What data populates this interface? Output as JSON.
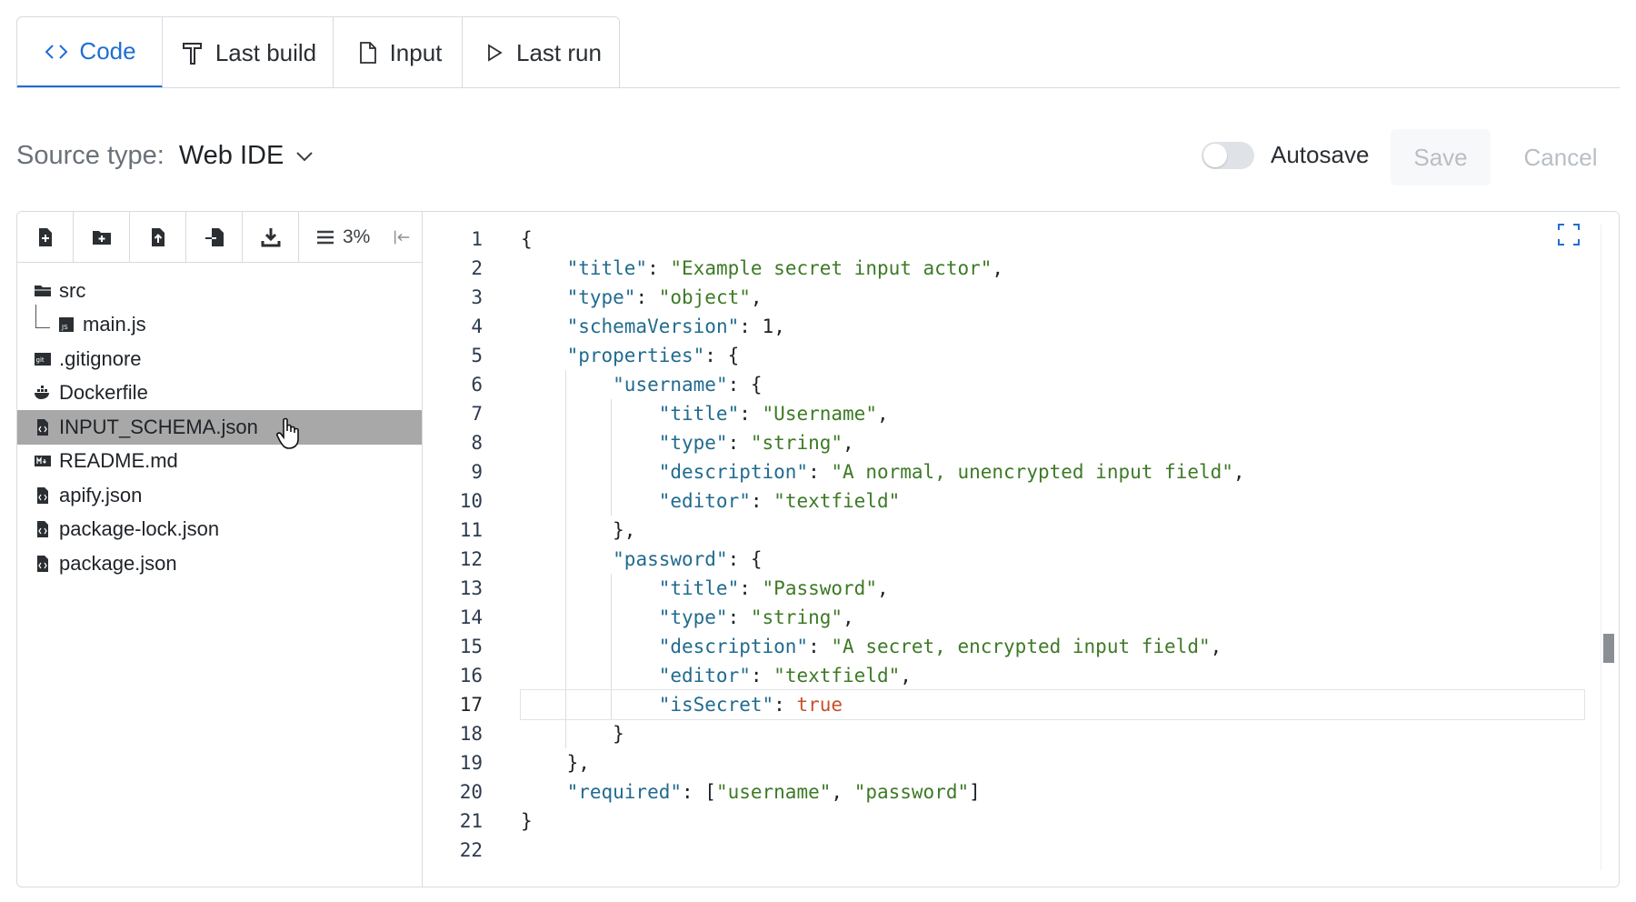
{
  "tabs": [
    {
      "label": "Code",
      "icon": "code-icon",
      "active": true
    },
    {
      "label": "Last build",
      "icon": "hammer-icon",
      "active": false
    },
    {
      "label": "Input",
      "icon": "file-icon",
      "active": false
    },
    {
      "label": "Last run",
      "icon": "play-icon",
      "active": false
    }
  ],
  "source": {
    "label": "Source type:",
    "value": "Web IDE"
  },
  "autosave": {
    "label": "Autosave",
    "enabled": false
  },
  "actions": {
    "save": "Save",
    "cancel": "Cancel"
  },
  "toolbar": {
    "buttons": [
      "new-file-icon",
      "new-folder-icon",
      "upload-file-icon",
      "import-icon",
      "download-icon"
    ],
    "zoom": "3%"
  },
  "files": [
    {
      "name": "src",
      "icon": "folder-icon",
      "level": 0
    },
    {
      "name": "main.js",
      "icon": "js-file-icon",
      "level": 1
    },
    {
      "name": ".gitignore",
      "icon": "git-icon",
      "level": 0
    },
    {
      "name": "Dockerfile",
      "icon": "docker-icon",
      "level": 0
    },
    {
      "name": "INPUT_SCHEMA.json",
      "icon": "json-file-icon",
      "level": 0,
      "selected": true
    },
    {
      "name": "README.md",
      "icon": "markdown-icon",
      "level": 0
    },
    {
      "name": "apify.json",
      "icon": "json-file-icon",
      "level": 0
    },
    {
      "name": "package-lock.json",
      "icon": "json-file-icon",
      "level": 0
    },
    {
      "name": "package.json",
      "icon": "json-file-icon",
      "level": 0
    }
  ],
  "editor": {
    "active_line": 17,
    "lines": [
      "{",
      "    \"title\": \"Example secret input actor\",",
      "    \"type\": \"object\",",
      "    \"schemaVersion\": 1,",
      "    \"properties\": {",
      "        \"username\": {",
      "            \"title\": \"Username\",",
      "            \"type\": \"string\",",
      "            \"description\": \"A normal, unencrypted input field\",",
      "            \"editor\": \"textfield\"",
      "        },",
      "        \"password\": {",
      "            \"title\": \"Password\",",
      "            \"type\": \"string\",",
      "            \"description\": \"A secret, encrypted input field\",",
      "            \"editor\": \"textfield\",",
      "            \"isSecret\": true",
      "        }",
      "    },",
      "    \"required\": [\"username\", \"password\"]",
      "}",
      ""
    ]
  }
}
